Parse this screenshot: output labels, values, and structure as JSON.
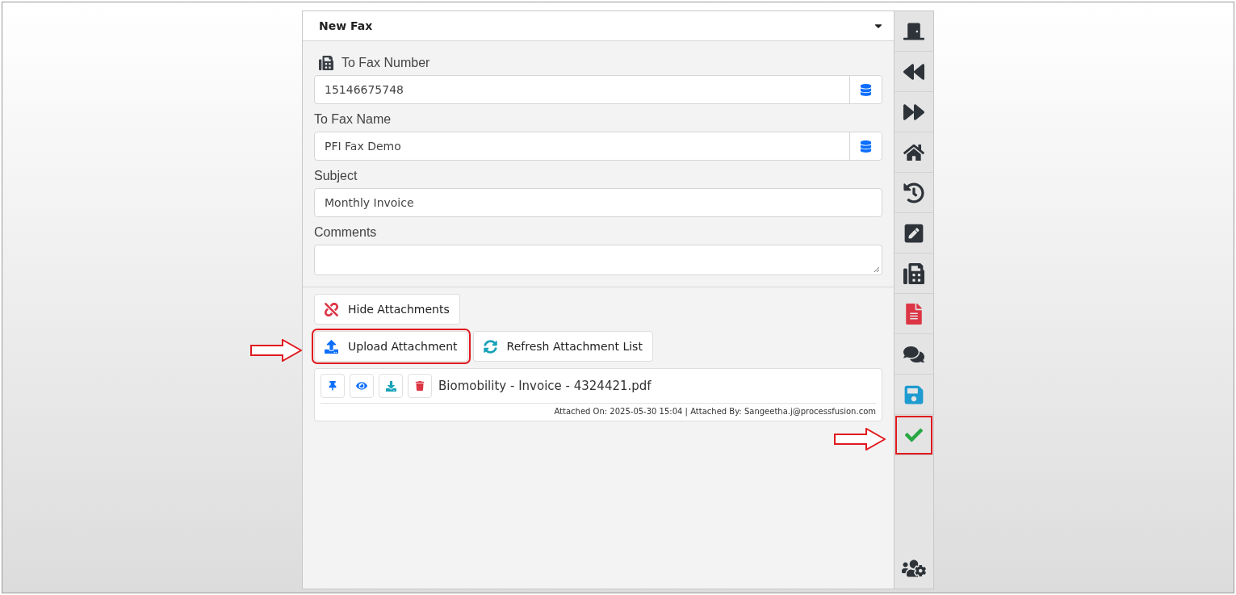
{
  "header": {
    "title": "New Fax"
  },
  "fields": [
    {
      "label": "To Fax Number",
      "kind": "lookup",
      "value": "15146675748",
      "label_icon": true
    },
    {
      "label": "To Fax Name",
      "kind": "lookup",
      "value": "PFI Fax Demo",
      "label_icon": false
    },
    {
      "label": "Subject",
      "kind": "text",
      "value": "Monthly Invoice",
      "label_icon": false
    },
    {
      "label": "Comments",
      "kind": "textarea",
      "label_icon": false
    }
  ],
  "attachment_buttons": [
    {
      "label": "Hide Attachments",
      "highlighted": false
    },
    {
      "label": "Upload Attachment",
      "highlighted": true
    },
    {
      "label": "Refresh Attachment List",
      "highlighted": false
    }
  ],
  "attachments": [
    {
      "name": "Biomobility - Invoice - 4324421.pdf",
      "meta": "Attached On: 2025-05-30 15:04 | Attached By: Sangeetha.j@processfusion.com"
    }
  ],
  "sidebar": {
    "items": [
      {
        "highlighted": false
      },
      {
        "highlighted": false
      },
      {
        "highlighted": false
      },
      {
        "highlighted": false
      },
      {
        "highlighted": false
      },
      {
        "highlighted": false
      },
      {
        "highlighted": false
      },
      {
        "highlighted": false
      },
      {
        "highlighted": false
      },
      {
        "highlighted": false
      },
      {
        "highlighted": true
      }
    ],
    "footer": {
      "highlighted": false
    }
  }
}
